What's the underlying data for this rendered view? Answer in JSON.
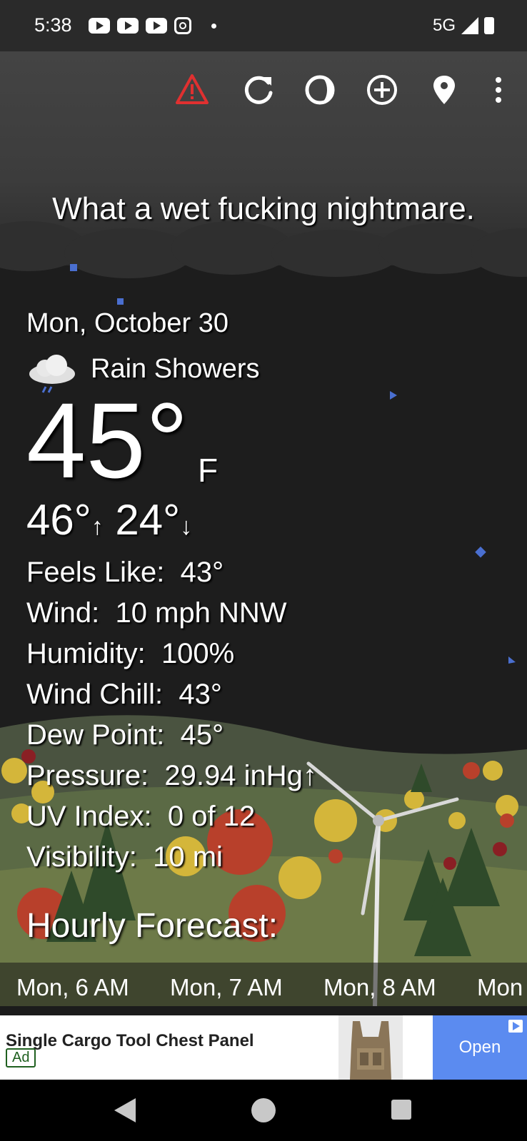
{
  "status_bar": {
    "time": "5:38",
    "network": "5G"
  },
  "toolbar": {
    "icons": [
      "warning-icon",
      "refresh-icon",
      "theme-icon",
      "add-location-icon",
      "location-pin-icon",
      "more-vert-icon"
    ]
  },
  "snark": "What a wet fucking nightmare.",
  "weather": {
    "date": "Mon, October 30",
    "condition": "Rain Showers",
    "condition_icon": "rain-cloud-icon",
    "temperature": "45°",
    "unit": "F",
    "high": "46°",
    "high_arrow": "↑",
    "low": "24°",
    "low_arrow": "↓"
  },
  "stats": [
    {
      "label": "Feels Like:",
      "value": "43°"
    },
    {
      "label": "Wind:",
      "value": "10 mph NNW"
    },
    {
      "label": "Humidity:",
      "value": "100%"
    },
    {
      "label": "Wind Chill:",
      "value": "43°"
    },
    {
      "label": "Dew Point:",
      "value": "45°"
    },
    {
      "label": "Pressure:",
      "value": "29.94 inHg↑"
    },
    {
      "label": "UV Index:",
      "value": "0 of 12"
    },
    {
      "label": "Visibility:",
      "value": "10 mi"
    }
  ],
  "hourly": {
    "title": "Hourly Forecast:",
    "hours": [
      "Mon, 6 AM",
      "Mon, 7 AM",
      "Mon, 8 AM",
      "Mon"
    ]
  },
  "ad": {
    "title": "Single Cargo Tool Chest Panel",
    "badge": "Ad",
    "cta": "Open"
  },
  "colors": {
    "warning": "#e03030",
    "ad_button": "#5b8bf0",
    "background": "#1d1d1d"
  }
}
